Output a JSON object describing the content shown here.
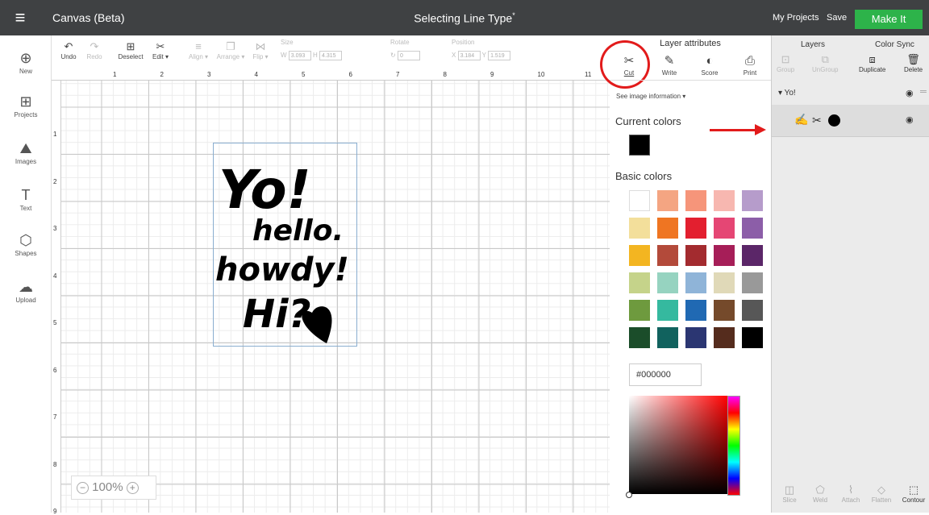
{
  "header": {
    "menu_icon": "hamburger-icon",
    "app_title": "Canvas (Beta)",
    "doc_title": "Selecting Line Type",
    "unsaved_mark": "*",
    "my_projects": "My Projects",
    "save": "Save",
    "make_it": "Make It"
  },
  "sidebar": [
    {
      "icon": "plus-circle-icon",
      "label": "New"
    },
    {
      "icon": "projects-icon",
      "label": "Projects"
    },
    {
      "icon": "images-icon",
      "label": "Images"
    },
    {
      "icon": "text-icon",
      "label": "Text"
    },
    {
      "icon": "shapes-icon",
      "label": "Shapes"
    },
    {
      "icon": "upload-icon",
      "label": "Upload"
    }
  ],
  "toolbar": {
    "undo": "Undo",
    "redo": "Redo",
    "deselect": "Deselect",
    "edit": "Edit ▾",
    "align": "Align ▾",
    "arrange": "Arrange ▾",
    "flip": "Flip ▾",
    "size": "Size",
    "w_label": "W",
    "w_value": "3.093",
    "h_label": "H",
    "h_value": "4.315",
    "rotate": "Rotate",
    "rotate_value": "0",
    "position": "Position",
    "x_label": "X",
    "x_value": "3.184",
    "y_label": "Y",
    "y_value": "1.519"
  },
  "ruler": {
    "h": [
      "1",
      "2",
      "3",
      "4",
      "5",
      "6",
      "7",
      "8",
      "9",
      "10",
      "11"
    ],
    "v": [
      "1",
      "2",
      "3",
      "4",
      "5",
      "6",
      "7",
      "8",
      "9"
    ]
  },
  "zoom": {
    "minus": "−",
    "value": "100%",
    "plus": "+"
  },
  "layer_attributes": {
    "title": "Layer attributes",
    "tabs": [
      "Cut",
      "Write",
      "Score",
      "Print"
    ],
    "image_info": "See image information ▾",
    "current_colors": "Current colors",
    "current_color": "#000000",
    "basic_colors": "Basic colors",
    "hex": "#000000",
    "swatches": [
      "#ffffff",
      "#f4a582",
      "#f6957a",
      "#f7b7b0",
      "#b69ccb",
      "#f3df9b",
      "#ef7522",
      "#e31f2f",
      "#e54674",
      "#8c5ea8",
      "#f3b521",
      "#b34a3a",
      "#a32b2f",
      "#a61e58",
      "#5b2668",
      "#c5d38a",
      "#96d3c0",
      "#8fb4d8",
      "#e0d9b8",
      "#999999",
      "#6e9a3e",
      "#35b99f",
      "#2069b3",
      "#754a2b",
      "#575757",
      "#1b4d2a",
      "#11625e",
      "#2b3672",
      "#552c1d",
      "#000000"
    ]
  },
  "layers_panel": {
    "layers": "Layers",
    "color_sync": "Color Sync",
    "group": "Group",
    "ungroup": "UnGroup",
    "duplicate": "Duplicate",
    "delete": "Delete",
    "layer_name": "▾ Yo!",
    "bottom": [
      "Slice",
      "Weld",
      "Attach",
      "Flatten",
      "Contour"
    ]
  },
  "artwork": {
    "lines": [
      "Yo!",
      "hello.",
      "howdy!",
      "Hi?"
    ]
  }
}
